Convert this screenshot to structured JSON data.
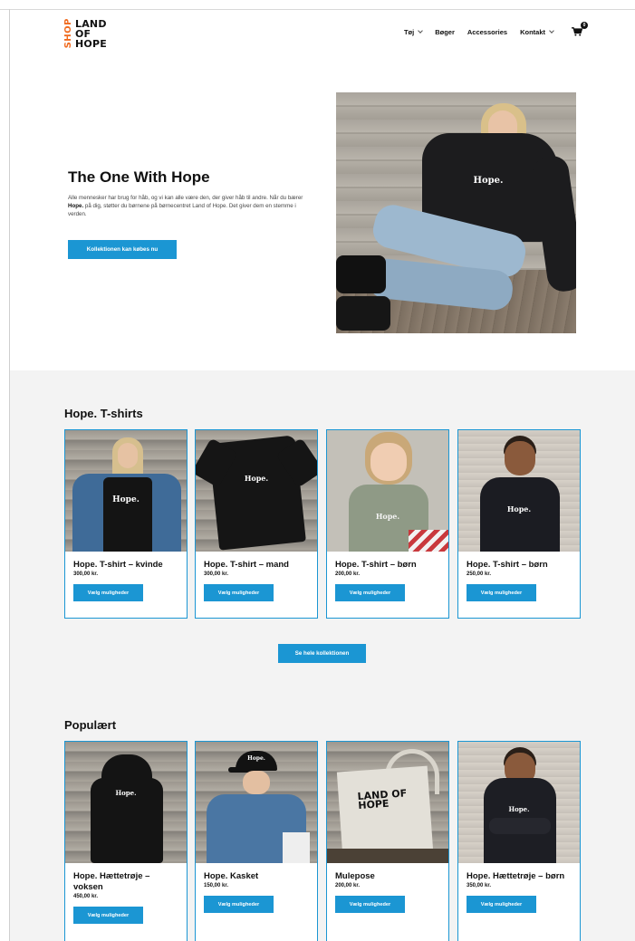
{
  "header": {
    "logo": {
      "shop": "SHOP",
      "line1": "LAND",
      "line2": "OF",
      "line3": "HOPE"
    },
    "nav": [
      {
        "label": "Tøj",
        "dropdown": true
      },
      {
        "label": "Bøger",
        "dropdown": false
      },
      {
        "label": "Accessories",
        "dropdown": false
      },
      {
        "label": "Kontakt",
        "dropdown": true
      }
    ],
    "cart_count": "0"
  },
  "hero": {
    "title": "The One With Hope",
    "text_before": "Alle mennesker har brug for håb, og vi kan alle være den, der giver håb til andre. Når du bærer ",
    "text_bold": "Hope.",
    "text_after": " på dig, støtter du børnene på børnecentret Land of Hope. Det giver dem en stemme i verden.",
    "button": "Kollektionen kan købes nu",
    "image_text": "Hope."
  },
  "tshirts": {
    "title": "Hope. T-shirts",
    "products": [
      {
        "name": "Hope. T-shirt – kvinde",
        "price": "300,00 kr.",
        "button": "Vælg muligheder",
        "print": "Hope."
      },
      {
        "name": "Hope. T-shirt – mand",
        "price": "300,00 kr.",
        "button": "Vælg muligheder",
        "print": "Hope."
      },
      {
        "name": "Hope. T-shirt – børn",
        "price": "200,00 kr.",
        "button": "Vælg muligheder",
        "print": "Hope."
      },
      {
        "name": "Hope. T-shirt – børn",
        "price": "250,00 kr.",
        "button": "Vælg muligheder",
        "print": "Hope."
      }
    ],
    "see_all": "Se hele kollektionen"
  },
  "popular": {
    "title": "Populært",
    "products": [
      {
        "name": "Hope. Hættetrøje – voksen",
        "price": "450,00 kr.",
        "button": "Vælg muligheder",
        "print": "Hope."
      },
      {
        "name": "Hope. Kasket",
        "price": "150,00 kr.",
        "button": "Vælg muligheder",
        "print": "Hope."
      },
      {
        "name": "Mulepose",
        "price": "200,00 kr.",
        "button": "Vælg muligheder",
        "print": "LAND OF HOPE"
      },
      {
        "name": "Hope. Hættetrøje – børn",
        "price": "350,00 kr.",
        "button": "Vælg muligheder",
        "print": "Hope."
      }
    ]
  },
  "colors": {
    "accent": "#1b96d3",
    "brand_orange": "#f06a1e",
    "section_bg": "#f3f3f3"
  },
  "icons": {
    "cart": "cart-icon",
    "caret": "chevron-down-icon"
  }
}
